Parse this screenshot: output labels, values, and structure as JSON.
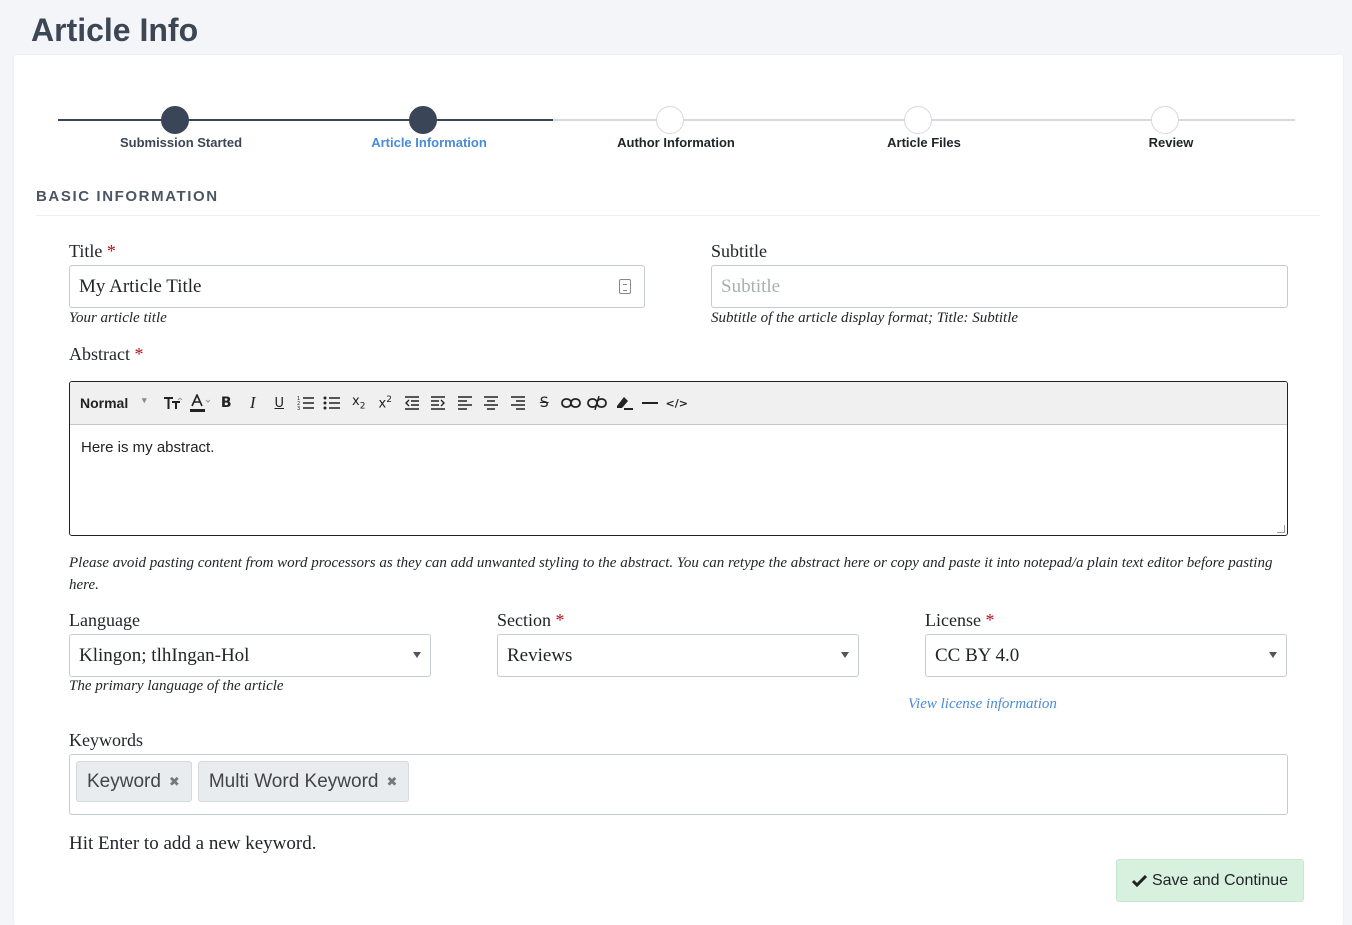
{
  "page": {
    "title": "Article Info"
  },
  "stepper": {
    "steps": [
      {
        "label": "Submission Started",
        "state": "done"
      },
      {
        "label": "Article Information",
        "state": "active"
      },
      {
        "label": "Author Information",
        "state": "pending"
      },
      {
        "label": "Article Files",
        "state": "pending"
      },
      {
        "label": "Review",
        "state": "pending"
      }
    ]
  },
  "section": {
    "heading": "BASIC INFORMATION"
  },
  "form": {
    "required_mark": "*",
    "title": {
      "label": "Title",
      "value": "My Article Title",
      "help": "Your article title"
    },
    "subtitle": {
      "label": "Subtitle",
      "placeholder": "Subtitle",
      "help": "Subtitle of the article display format; Title: Subtitle"
    },
    "abstract": {
      "label": "Abstract",
      "format": "Normal",
      "content": "Here is my abstract.",
      "help": "Please avoid pasting content from word processors as they can add unwanted styling to the abstract. You can retype the abstract here or copy and paste it into notepad/a plain text editor before pasting here."
    },
    "language": {
      "label": "Language",
      "value": "Klingon; tlhIngan-Hol",
      "help": "The primary language of the article"
    },
    "section": {
      "label": "Section",
      "value": "Reviews"
    },
    "license": {
      "label": "License",
      "value": "CC BY 4.0",
      "link": "View license information"
    },
    "keywords": {
      "label": "Keywords",
      "tags": [
        "Keyword",
        "Multi Word Keyword"
      ],
      "note": "Hit Enter to add a new keyword."
    },
    "save_label": "Save and Continue"
  },
  "toolbar_icons": [
    "text-size-icon",
    "text-color-icon",
    "bold-icon",
    "italic-icon",
    "underline-icon",
    "ordered-list-icon",
    "bullet-list-icon",
    "subscript-icon",
    "superscript-icon",
    "outdent-icon",
    "indent-icon",
    "align-left-icon",
    "align-center-icon",
    "align-right-icon",
    "strikethrough-icon",
    "link-icon",
    "unlink-icon",
    "clear-format-icon",
    "horizontal-rule-icon",
    "code-view-icon"
  ],
  "colors": {
    "active_step": "#4a8bd6",
    "done_step": "#3a4658",
    "required": "#b1121c",
    "save_button_bg": "#d7f1de"
  }
}
